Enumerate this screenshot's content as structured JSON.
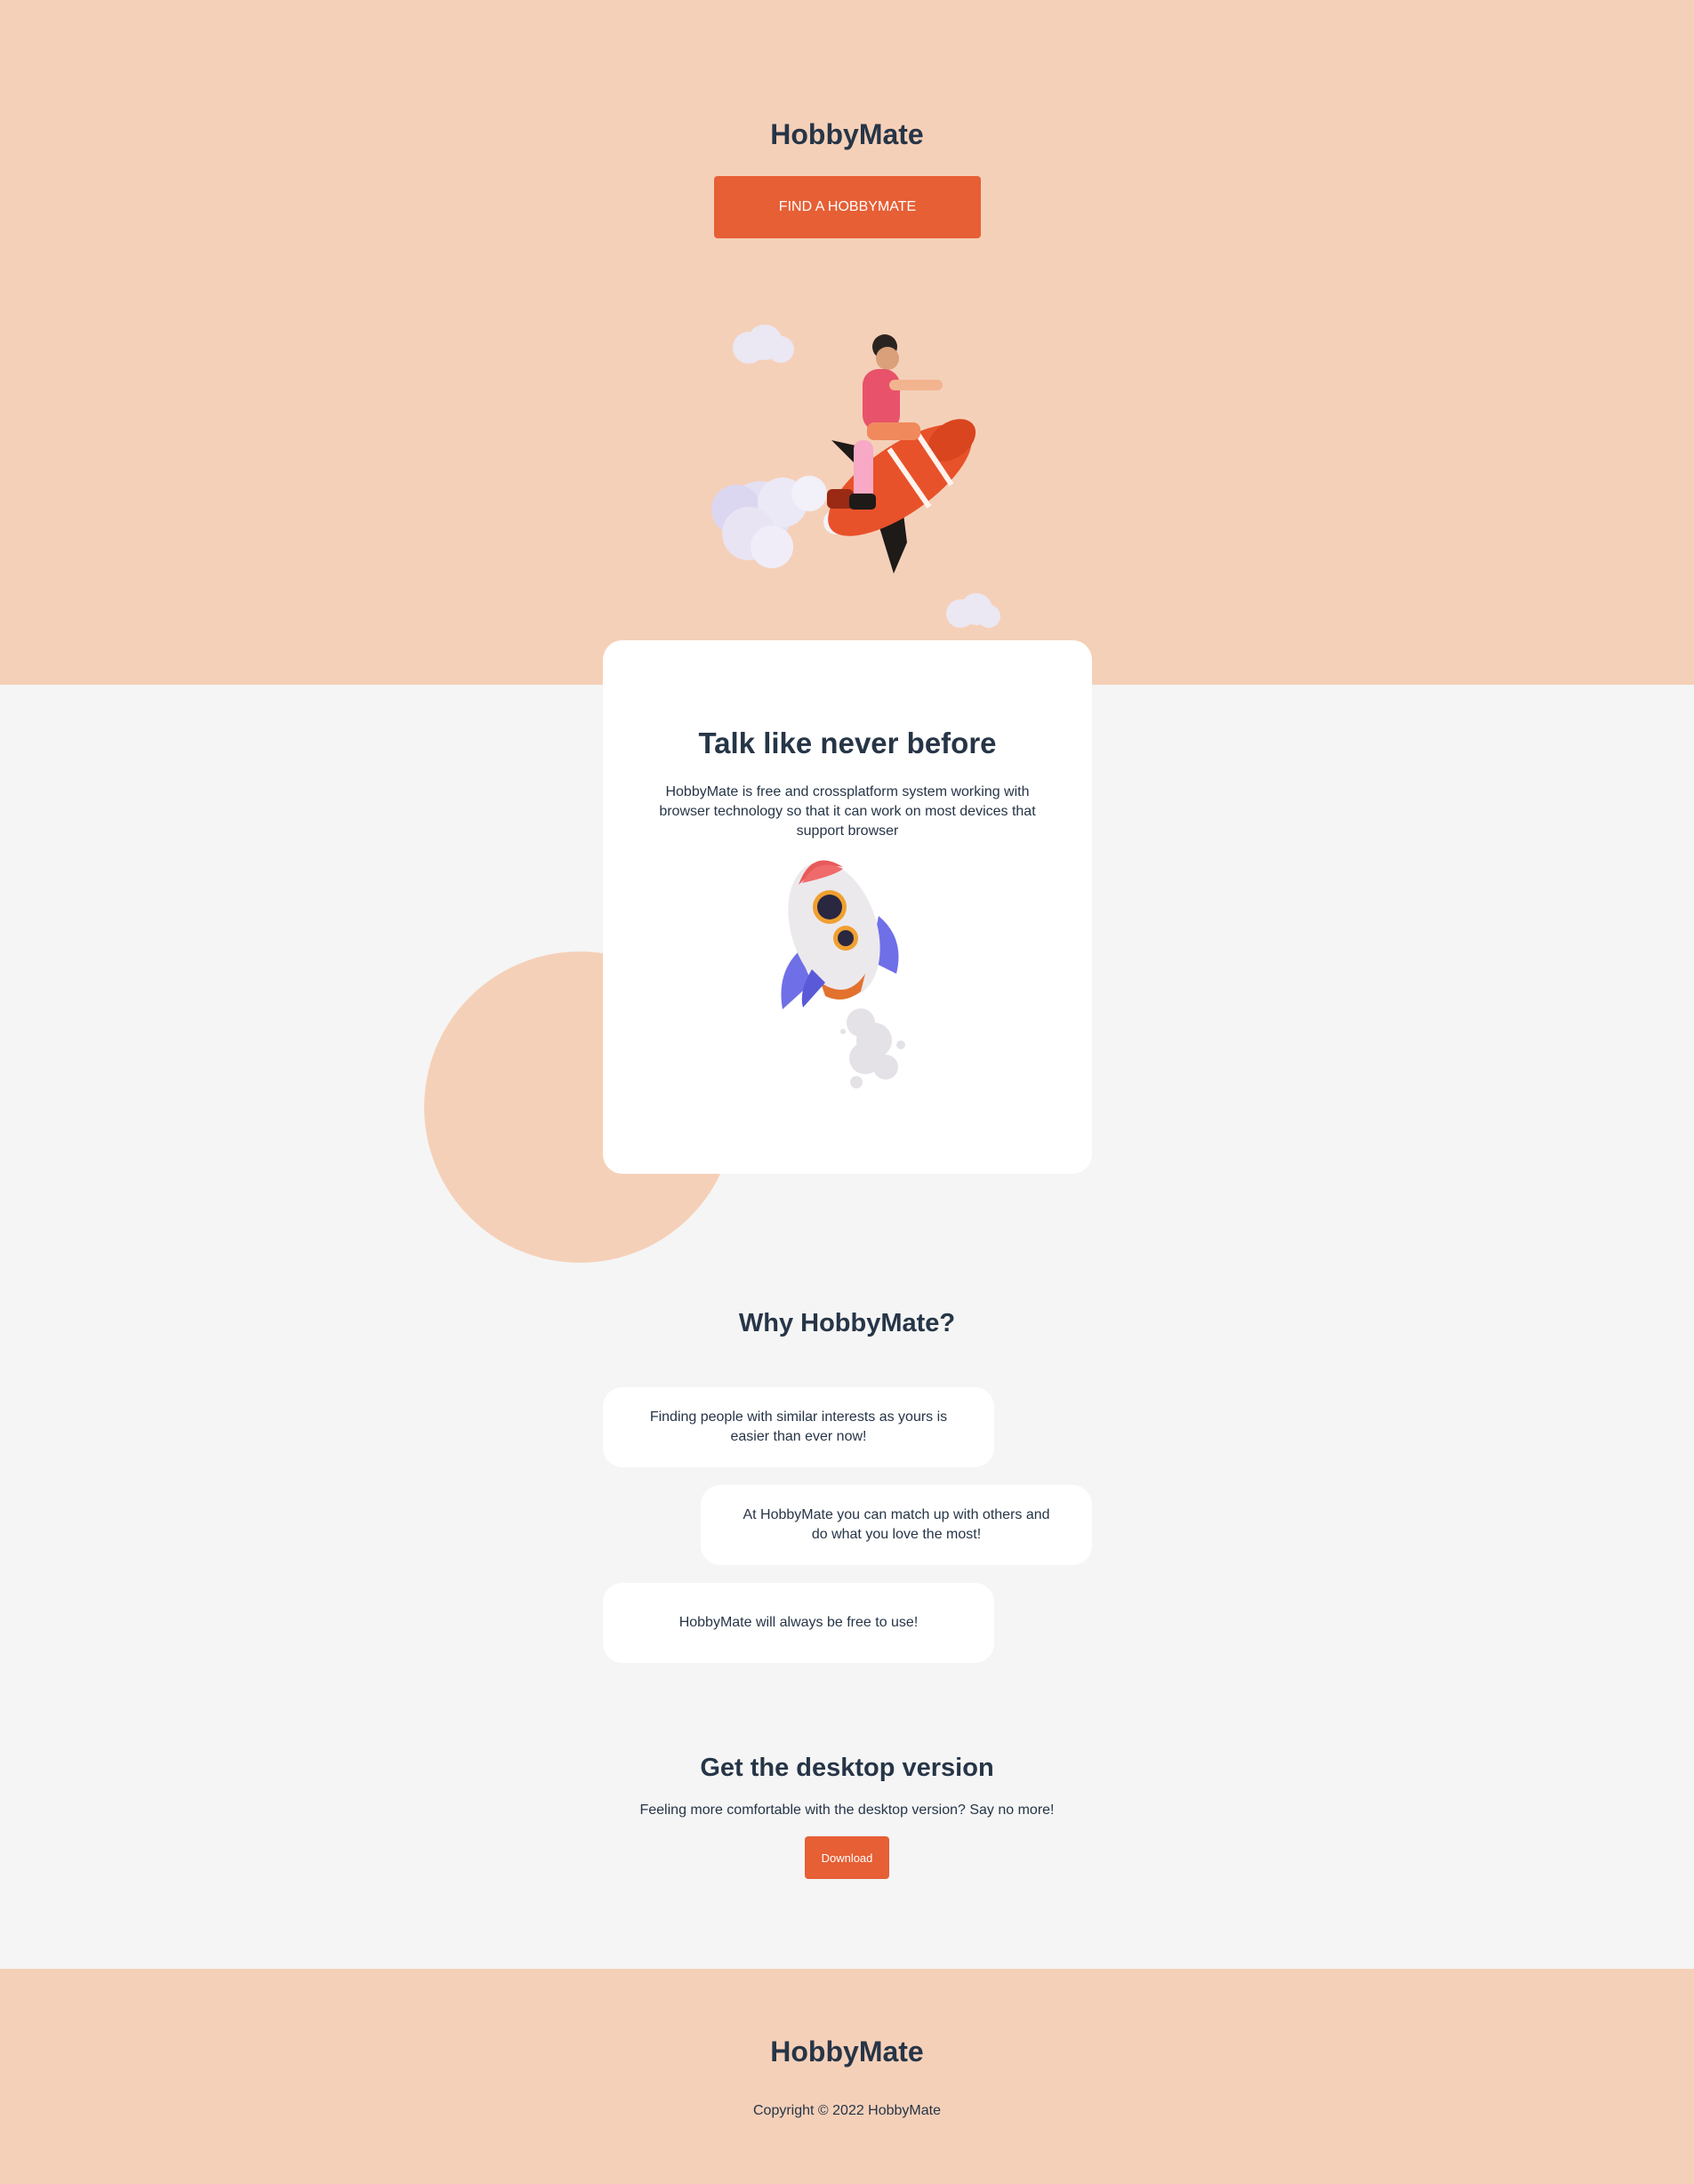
{
  "hero": {
    "brand": "HobbyMate",
    "cta_label": "FIND A HOBBYMATE"
  },
  "feature_card": {
    "title": "Talk like never before",
    "text": "HobbyMate is free and crossplatform system working with browser technology so that it can work on most devices that support browser"
  },
  "why": {
    "title": "Why HobbyMate?",
    "items": [
      "Finding people with similar interests as yours is easier than ever now!",
      "At HobbyMate you can match up with others and do what you love the most!",
      "HobbyMate will always be free to use!"
    ]
  },
  "desktop": {
    "title": "Get the desktop version",
    "text": "Feeling more comfortable with the desktop version? Say no more!",
    "button_label": "Download"
  },
  "footer": {
    "brand": "HobbyMate",
    "copyright": "Copyright © 2022 HobbyMate"
  },
  "colors": {
    "peach": "#f5d0b8",
    "accent": "#e65f35",
    "text": "#263547",
    "background": "#f5f5f5"
  }
}
